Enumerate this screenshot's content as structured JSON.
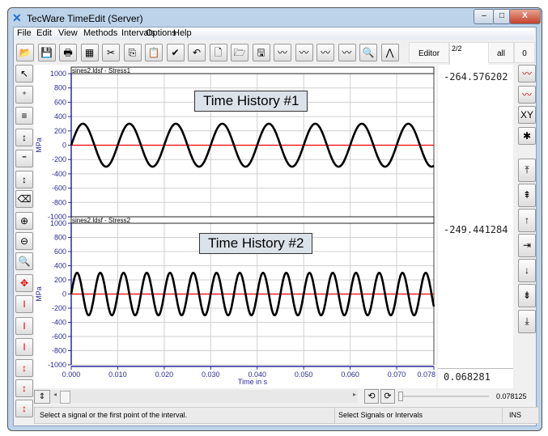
{
  "window": {
    "title": "TecWare TimeEdit (Server)",
    "minimize": "–",
    "maximize": "□",
    "close": "X"
  },
  "menu": [
    "File",
    "Edit",
    "View",
    "Methods",
    "Intervals",
    "Options",
    "Help"
  ],
  "toolbar": {
    "icons": [
      "open-icon",
      "save-icon",
      "print-icon",
      "clipboard-icon",
      "cut-icon",
      "copy-icon",
      "paste-icon",
      "check-icon",
      "undo-icon",
      "new-signal-icon",
      "open-signal-icon",
      "save-signal-icon",
      "signal-view-1-icon",
      "signal-view-2-icon",
      "signal-view-3-icon",
      "signal-view-4-icon",
      "zoom-signal-icon",
      "peak-icon"
    ],
    "glyphs": [
      "📂",
      "💾",
      "🖶",
      "▦",
      "✂",
      "⎘",
      "📋",
      "✔",
      "↶",
      "🗋",
      "🗁",
      "🖫",
      "〰",
      "〰",
      "〰",
      "〰",
      "🔍",
      "⋀"
    ],
    "editor_label": "Editor",
    "page_value": "2/2",
    "all_label": "all",
    "count": "0"
  },
  "left_toolbar": {
    "icons": [
      "select-icon",
      "add-point-icon",
      "edit-point-icon",
      "move-icon",
      "signal-edit-icon",
      "signal-move-icon",
      "eraser-icon",
      "zoom-in-icon",
      "zoom-out-icon",
      "zoom-icon",
      "pan-icon",
      "scale-all-icon",
      "scale-icon",
      "scale-y-icon",
      "scale-all-small-icon",
      "scale-small-icon",
      "scale-y-small-icon"
    ],
    "glyphs": [
      "↖",
      "⁺",
      "≡",
      "↕",
      "⁼",
      "↕",
      "⌫",
      "⊕",
      "⊖",
      "🔍",
      "✥",
      "I",
      "I",
      "I",
      "↕",
      "↕",
      "↕"
    ]
  },
  "right_toolbar": {
    "icons": [
      "multi-signal-icon",
      "limits-icon",
      "xy-icon",
      "marker-icon",
      "first-icon",
      "page-up-icon",
      "up-icon",
      "goto-icon",
      "down-icon",
      "page-down-icon",
      "last-icon"
    ],
    "glyphs": [
      "〰",
      "〰",
      "XY",
      "✱",
      "⤒",
      "⇞",
      "↑",
      "⇥",
      "↓",
      "⇟",
      "⤓"
    ]
  },
  "values": {
    "signal1": "-264.576202",
    "signal2": "-249.441284",
    "cursor_time": "0.068281"
  },
  "scroll": {
    "end_value": "0.078125"
  },
  "status": {
    "hint": "Select a signal or the first point of the interval.",
    "mode": "Select Signals or Intervals",
    "ins": "INS"
  },
  "colors": {
    "axis": "#2a2a9a",
    "signal": "#000000",
    "zero_line": "#ff0000",
    "grid": "#d0d0d0",
    "annotation_fill": "#dce2ea"
  },
  "chart_data": [
    {
      "type": "line",
      "title": "sines2.ldsf - Stress1",
      "annotation": "Time History #1",
      "ylabel": "MPa",
      "xlabel": "",
      "ylim": [
        -1000,
        1000
      ],
      "yticks": [
        1000,
        800,
        600,
        400,
        200,
        0,
        -200,
        -400,
        -600,
        -800,
        -1000
      ],
      "xlim": [
        0,
        0.078
      ],
      "grid": true,
      "series": [
        {
          "function": "sine",
          "amplitude": 300,
          "frequency_hz": 100
        }
      ],
      "reference_line": 0
    },
    {
      "type": "line",
      "title": "sines2.ldsf - Stress2",
      "annotation": "Time History #2",
      "ylabel": "MPa",
      "xlabel": "Time in s",
      "ylim": [
        -1000,
        1000
      ],
      "yticks": [
        1000,
        800,
        600,
        400,
        200,
        0,
        -200,
        -400,
        -600,
        -800,
        -1000
      ],
      "xlim": [
        0,
        0.078
      ],
      "grid": true,
      "xticks": [
        "0.000",
        "0.010",
        "0.020",
        "0.030",
        "0.040",
        "0.050",
        "0.060",
        "0.070",
        "0.078"
      ],
      "series": [
        {
          "function": "sine",
          "amplitude": 300,
          "frequency_hz": 200
        }
      ],
      "reference_line": 0
    }
  ]
}
